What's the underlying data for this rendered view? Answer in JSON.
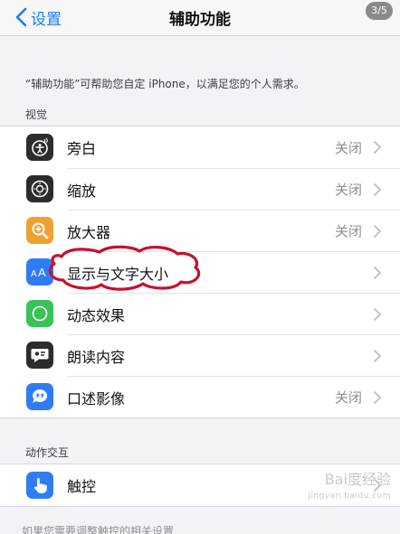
{
  "nav": {
    "back_label": "设置",
    "title": "辅助功能",
    "page_indicator": "3/5"
  },
  "description": "“辅助功能”可帮助您自定 iPhone，以满足您的个人需求。",
  "sections": [
    {
      "header": "视觉",
      "items": [
        {
          "label": "旁白",
          "value": "关闭",
          "icon": "voiceover-icon",
          "color": "#2c2c2e"
        },
        {
          "label": "缩放",
          "value": "关闭",
          "icon": "zoom-icon",
          "color": "#2c2c2e"
        },
        {
          "label": "放大器",
          "value": "关闭",
          "icon": "magnifier-icon",
          "color": "#f0a030"
        },
        {
          "label": "显示与文字大小",
          "value": "",
          "icon": "text-size-icon",
          "color": "#2f7cf6"
        },
        {
          "label": "动态效果",
          "value": "",
          "icon": "motion-icon",
          "color": "#3ac25a"
        },
        {
          "label": "朗读内容",
          "value": "",
          "icon": "spoken-content-icon",
          "color": "#2c2c2e"
        },
        {
          "label": "口述影像",
          "value": "关闭",
          "icon": "audio-description-icon",
          "color": "#2f7cf6"
        }
      ]
    },
    {
      "header": "动作交互",
      "items": [
        {
          "label": "触控",
          "value": "",
          "icon": "touch-icon",
          "color": "#2f7cf6"
        }
      ]
    }
  ],
  "bottom_text": "如果您需要调整触控的相关设置",
  "watermark": {
    "brand": "Bai度经验",
    "url": "jingyan.baidu.com"
  },
  "colors": {
    "accent": "#1a7cf5",
    "annotation": "#c8102e"
  }
}
